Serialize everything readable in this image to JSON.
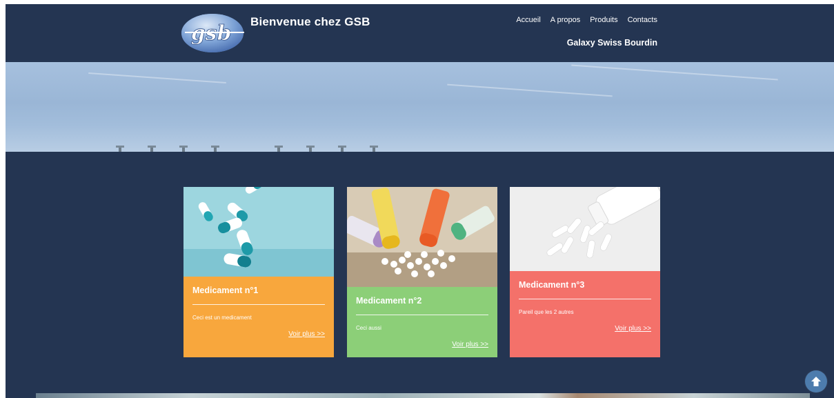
{
  "header": {
    "logo_text": "gsb",
    "title": "Bienvenue chez GSB",
    "subtitle": "Galaxy Swiss Bourdin",
    "nav": [
      {
        "label": "Accueil"
      },
      {
        "label": "A propos"
      },
      {
        "label": "Produits"
      },
      {
        "label": "Contacts"
      }
    ]
  },
  "cards": [
    {
      "title": "Medicament n°1",
      "description": "Ceci est un medicament",
      "link": "Voir plus >>",
      "color": "#f8a73d",
      "image": "capsules-image"
    },
    {
      "title": "Medicament n°2",
      "description": "Ceci aussi",
      "link": "Voir plus >>",
      "color": "#8ccf78",
      "image": "homeopathy-tubes-image"
    },
    {
      "title": "Medicament n°3",
      "description": "Pareil que les 2 autres",
      "link": "Voir plus >>",
      "color": "#f4716a",
      "image": "pill-bottle-image"
    }
  ],
  "colors": {
    "page_background": "#243552",
    "scroll_button": "#4d7cad"
  },
  "scroll_top": {
    "icon": "arrow-up-icon"
  }
}
